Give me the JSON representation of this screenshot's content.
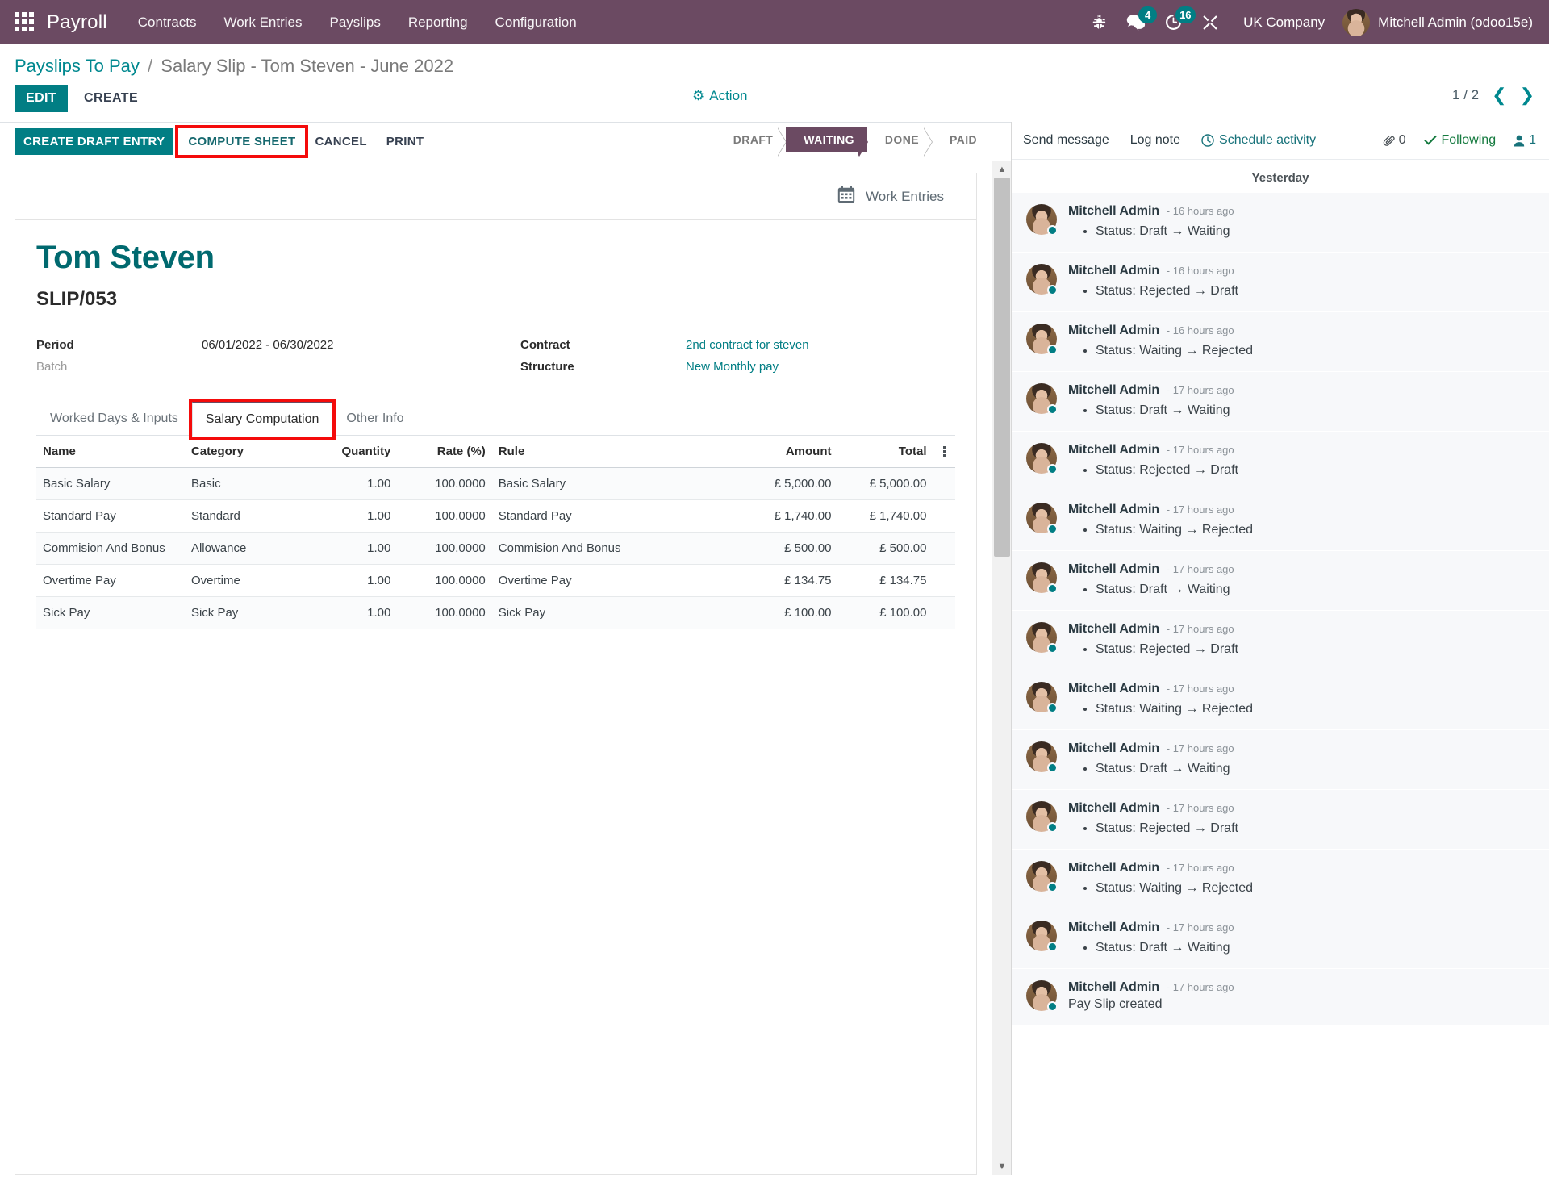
{
  "navbar": {
    "apps_icon": "apps-grid-icon",
    "brand": "Payroll",
    "menu": [
      "Contracts",
      "Work Entries",
      "Payslips",
      "Reporting",
      "Configuration"
    ],
    "bug_icon": "bug-icon",
    "messages_icon": "chat-bubble-icon",
    "messages_count": "4",
    "activity_icon": "clock-icon",
    "activity_count": "16",
    "tools_icon": "tools-icon",
    "company": "UK Company",
    "user": "Mitchell Admin (odoo15e)",
    "avatar_icon": "user-avatar"
  },
  "breadcrumb": {
    "root": "Payslips To Pay",
    "separator": "/",
    "current": "Salary Slip - Tom Steven - June 2022"
  },
  "control_panel": {
    "edit_label": "EDIT",
    "create_label": "CREATE",
    "action_label": "Action",
    "action_icon": "gear-icon",
    "pager_value": "1 / 2",
    "prev_icon": "chevron-left-icon",
    "next_icon": "chevron-right-icon"
  },
  "buttonbar": {
    "create_draft_entry": "CREATE DRAFT ENTRY",
    "compute_sheet": "COMPUTE SHEET",
    "cancel": "CANCEL",
    "print": "PRINT"
  },
  "statusbar": {
    "states": [
      "DRAFT",
      "WAITING",
      "DONE",
      "PAID"
    ],
    "active": "WAITING"
  },
  "smart_buttons": [
    {
      "label": "Work Entries",
      "icon": "calendar-icon"
    }
  ],
  "record": {
    "title": "Tom Steven",
    "reference": "SLIP/053",
    "fields_left": [
      {
        "label": "Period",
        "value": "06/01/2022 - 06/30/2022",
        "muted": false,
        "link": false
      },
      {
        "label": "Batch",
        "value": "",
        "muted": true,
        "link": false
      }
    ],
    "fields_right": [
      {
        "label": "Contract",
        "value": "2nd contract for steven",
        "muted": false,
        "link": true
      },
      {
        "label": "Structure",
        "value": "New Monthly pay",
        "muted": false,
        "link": true
      }
    ]
  },
  "notebook": {
    "tabs": [
      {
        "label": "Worked Days & Inputs",
        "active": false,
        "highlighted": false
      },
      {
        "label": "Salary Computation",
        "active": true,
        "highlighted": true
      },
      {
        "label": "Other Info",
        "active": false,
        "highlighted": false
      }
    ]
  },
  "lines_table": {
    "columns": [
      "Name",
      "Category",
      "Quantity",
      "Rate (%)",
      "Rule",
      "Amount",
      "Total"
    ],
    "optional_columns_icon": "vertical-dots-icon",
    "rows": [
      {
        "name": "Basic Salary",
        "category": "Basic",
        "quantity": "1.00",
        "rate": "100.0000",
        "rule": "Basic Salary",
        "amount": "£ 5,000.00",
        "total": "£ 5,000.00"
      },
      {
        "name": "Standard Pay",
        "category": "Standard",
        "quantity": "1.00",
        "rate": "100.0000",
        "rule": "Standard Pay",
        "amount": "£ 1,740.00",
        "total": "£ 1,740.00"
      },
      {
        "name": "Commision And Bonus",
        "category": "Allowance",
        "quantity": "1.00",
        "rate": "100.0000",
        "rule": "Commision And Bonus",
        "amount": "£ 500.00",
        "total": "£ 500.00"
      },
      {
        "name": "Overtime Pay",
        "category": "Overtime",
        "quantity": "1.00",
        "rate": "100.0000",
        "rule": "Overtime Pay",
        "amount": "£ 134.75",
        "total": "£ 134.75"
      },
      {
        "name": "Sick Pay",
        "category": "Sick Pay",
        "quantity": "1.00",
        "rate": "100.0000",
        "rule": "Sick Pay",
        "amount": "£ 100.00",
        "total": "£ 100.00"
      }
    ]
  },
  "chatter": {
    "send_message": "Send message",
    "log_note": "Log note",
    "schedule_activity": "Schedule activity",
    "schedule_icon": "clock-icon",
    "attachment_icon": "paperclip-icon",
    "attachment_count": "0",
    "following_icon": "check-icon",
    "following_label": "Following",
    "followers_icon": "person-icon",
    "followers_count": "1",
    "day_separator": "Yesterday",
    "messages": [
      {
        "author": "Mitchell Admin",
        "time": "- 16 hours ago",
        "tracking": "Status: Draft → Waiting",
        "plain": ""
      },
      {
        "author": "Mitchell Admin",
        "time": "- 16 hours ago",
        "tracking": "Status: Rejected → Draft",
        "plain": ""
      },
      {
        "author": "Mitchell Admin",
        "time": "- 16 hours ago",
        "tracking": "Status: Waiting → Rejected",
        "plain": ""
      },
      {
        "author": "Mitchell Admin",
        "time": "- 17 hours ago",
        "tracking": "Status: Draft → Waiting",
        "plain": ""
      },
      {
        "author": "Mitchell Admin",
        "time": "- 17 hours ago",
        "tracking": "Status: Rejected → Draft",
        "plain": ""
      },
      {
        "author": "Mitchell Admin",
        "time": "- 17 hours ago",
        "tracking": "Status: Waiting → Rejected",
        "plain": ""
      },
      {
        "author": "Mitchell Admin",
        "time": "- 17 hours ago",
        "tracking": "Status: Draft → Waiting",
        "plain": ""
      },
      {
        "author": "Mitchell Admin",
        "time": "- 17 hours ago",
        "tracking": "Status: Rejected → Draft",
        "plain": ""
      },
      {
        "author": "Mitchell Admin",
        "time": "- 17 hours ago",
        "tracking": "Status: Waiting → Rejected",
        "plain": ""
      },
      {
        "author": "Mitchell Admin",
        "time": "- 17 hours ago",
        "tracking": "Status: Draft → Waiting",
        "plain": ""
      },
      {
        "author": "Mitchell Admin",
        "time": "- 17 hours ago",
        "tracking": "Status: Rejected → Draft",
        "plain": ""
      },
      {
        "author": "Mitchell Admin",
        "time": "- 17 hours ago",
        "tracking": "Status: Waiting → Rejected",
        "plain": ""
      },
      {
        "author": "Mitchell Admin",
        "time": "- 17 hours ago",
        "tracking": "Status: Draft → Waiting",
        "plain": ""
      },
      {
        "author": "Mitchell Admin",
        "time": "- 17 hours ago",
        "tracking": "",
        "plain": "Pay Slip created"
      }
    ]
  },
  "colors": {
    "brand_purple": "#6b4a62",
    "accent_teal": "#017e84",
    "highlight_red": "#f40b0b"
  }
}
